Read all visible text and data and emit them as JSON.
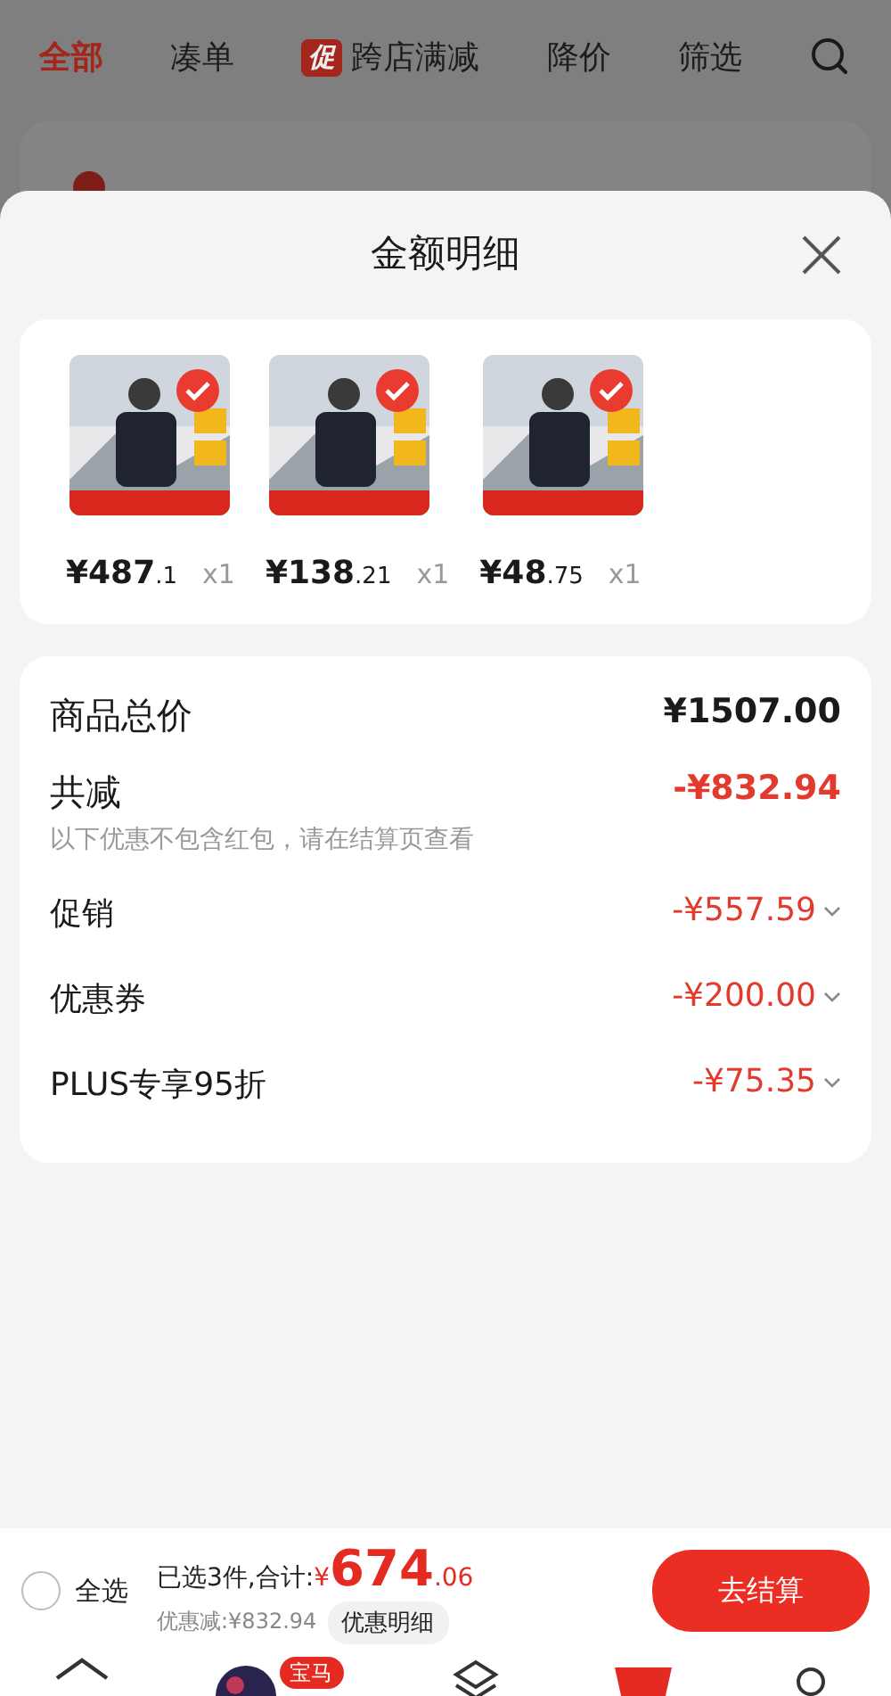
{
  "filter_tabs": [
    {
      "label": "全部",
      "selected": true
    },
    {
      "label": "凑单",
      "selected": false
    },
    {
      "label": "跨店满减",
      "selected": false,
      "badge": "促"
    },
    {
      "label": "降价",
      "selected": false
    },
    {
      "label": "筛选",
      "selected": false
    }
  ],
  "sheet": {
    "title": "金额明细",
    "products": [
      {
        "price": "¥487",
        "decimal": ".1",
        "quantity": "x1",
        "checked": true
      },
      {
        "price": "¥138",
        "decimal": ".21",
        "quantity": "x1",
        "checked": true
      },
      {
        "price": "¥48",
        "decimal": ".75",
        "quantity": "x1",
        "checked": true
      }
    ],
    "rows": [
      {
        "kind": "total",
        "label": "商品总价",
        "amount": "¥1507.00"
      },
      {
        "kind": "reduction",
        "label": "共减",
        "amount": "-¥832.94",
        "note": "以下优惠不包含红包，请在结算页查看"
      },
      {
        "kind": "item",
        "label": "促销",
        "amount": "-¥557.59"
      },
      {
        "kind": "item",
        "label": "优惠券",
        "amount": "-¥200.00"
      },
      {
        "kind": "item",
        "label": "PLUS专享95折",
        "amount": "-¥75.35"
      }
    ]
  },
  "checkout_bar": {
    "select_all": {
      "label": "全选",
      "checked": false
    },
    "summary": "已选3件,合计:",
    "currency": "¥",
    "total": "674",
    "total_decimal": ".06",
    "discount": "优惠减:¥832.94",
    "detail_button": "优惠明细",
    "checkout_button": "去结算"
  },
  "bottom_nav": {
    "avatar_badge": "宝马"
  }
}
